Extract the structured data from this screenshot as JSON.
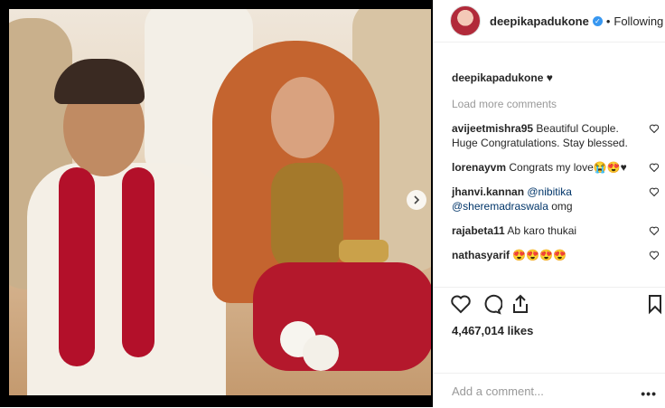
{
  "header": {
    "username": "deepikapadukone",
    "separator": "•",
    "follow_label": "Following"
  },
  "caption": {
    "username": "deepikapadukone",
    "text": "♥"
  },
  "load_more": "Load more comments",
  "comments": [
    {
      "username": "avijeetmishra95",
      "text": "Beautiful Couple. Huge Congratulations. Stay blessed."
    },
    {
      "username": "lorenayvm",
      "text": "Congrats my love😭😍♥"
    },
    {
      "username": "jhanvi.kannan",
      "mention1": "@nibitika",
      "mention2": "@sheremadraswala",
      "text": "omg"
    },
    {
      "username": "rajabeta11",
      "text": "Ab karo thukai"
    },
    {
      "username": "nathasyarif",
      "text": "😍😍😍😍"
    }
  ],
  "likes": "4,467,014 likes",
  "add_comment_placeholder": "Add a comment...",
  "more_label": "•••",
  "icons": {
    "like": "heart-icon",
    "comment": "comment-icon",
    "share": "share-icon",
    "save": "bookmark-icon",
    "next": "chevron-right-icon"
  }
}
